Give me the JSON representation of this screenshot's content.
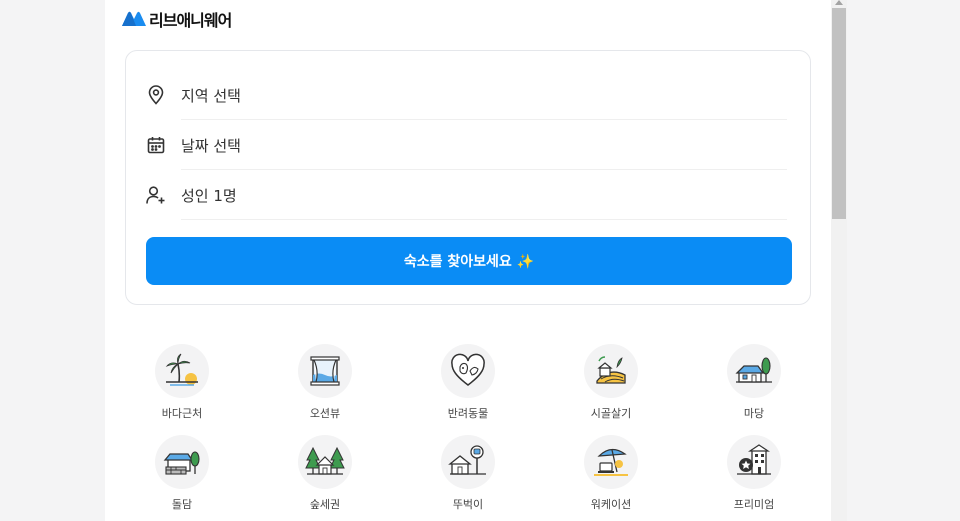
{
  "header": {
    "logo_text": "리브애니웨어"
  },
  "search": {
    "region_label": "지역 선택",
    "date_label": "날짜 선택",
    "guests_label": "성인 1명",
    "button_label": "숙소를 찾아보세요 ✨"
  },
  "categories": [
    {
      "label": "바다근처",
      "icon": "palm-beach-icon"
    },
    {
      "label": "오션뷰",
      "icon": "ocean-window-icon"
    },
    {
      "label": "반려동물",
      "icon": "pet-heart-icon"
    },
    {
      "label": "시골살기",
      "icon": "countryside-icon"
    },
    {
      "label": "마당",
      "icon": "yard-house-icon"
    },
    {
      "label": "돌담",
      "icon": "stone-wall-house-icon"
    },
    {
      "label": "숲세권",
      "icon": "forest-house-icon"
    },
    {
      "label": "뚜벅이",
      "icon": "bus-stop-icon"
    },
    {
      "label": "워케이션",
      "icon": "workation-icon"
    },
    {
      "label": "프리미엄",
      "icon": "premium-building-icon"
    }
  ],
  "colors": {
    "primary": "#0a8cf5",
    "logo_blue": "#1a8cf0",
    "border": "#e5e7eb"
  }
}
